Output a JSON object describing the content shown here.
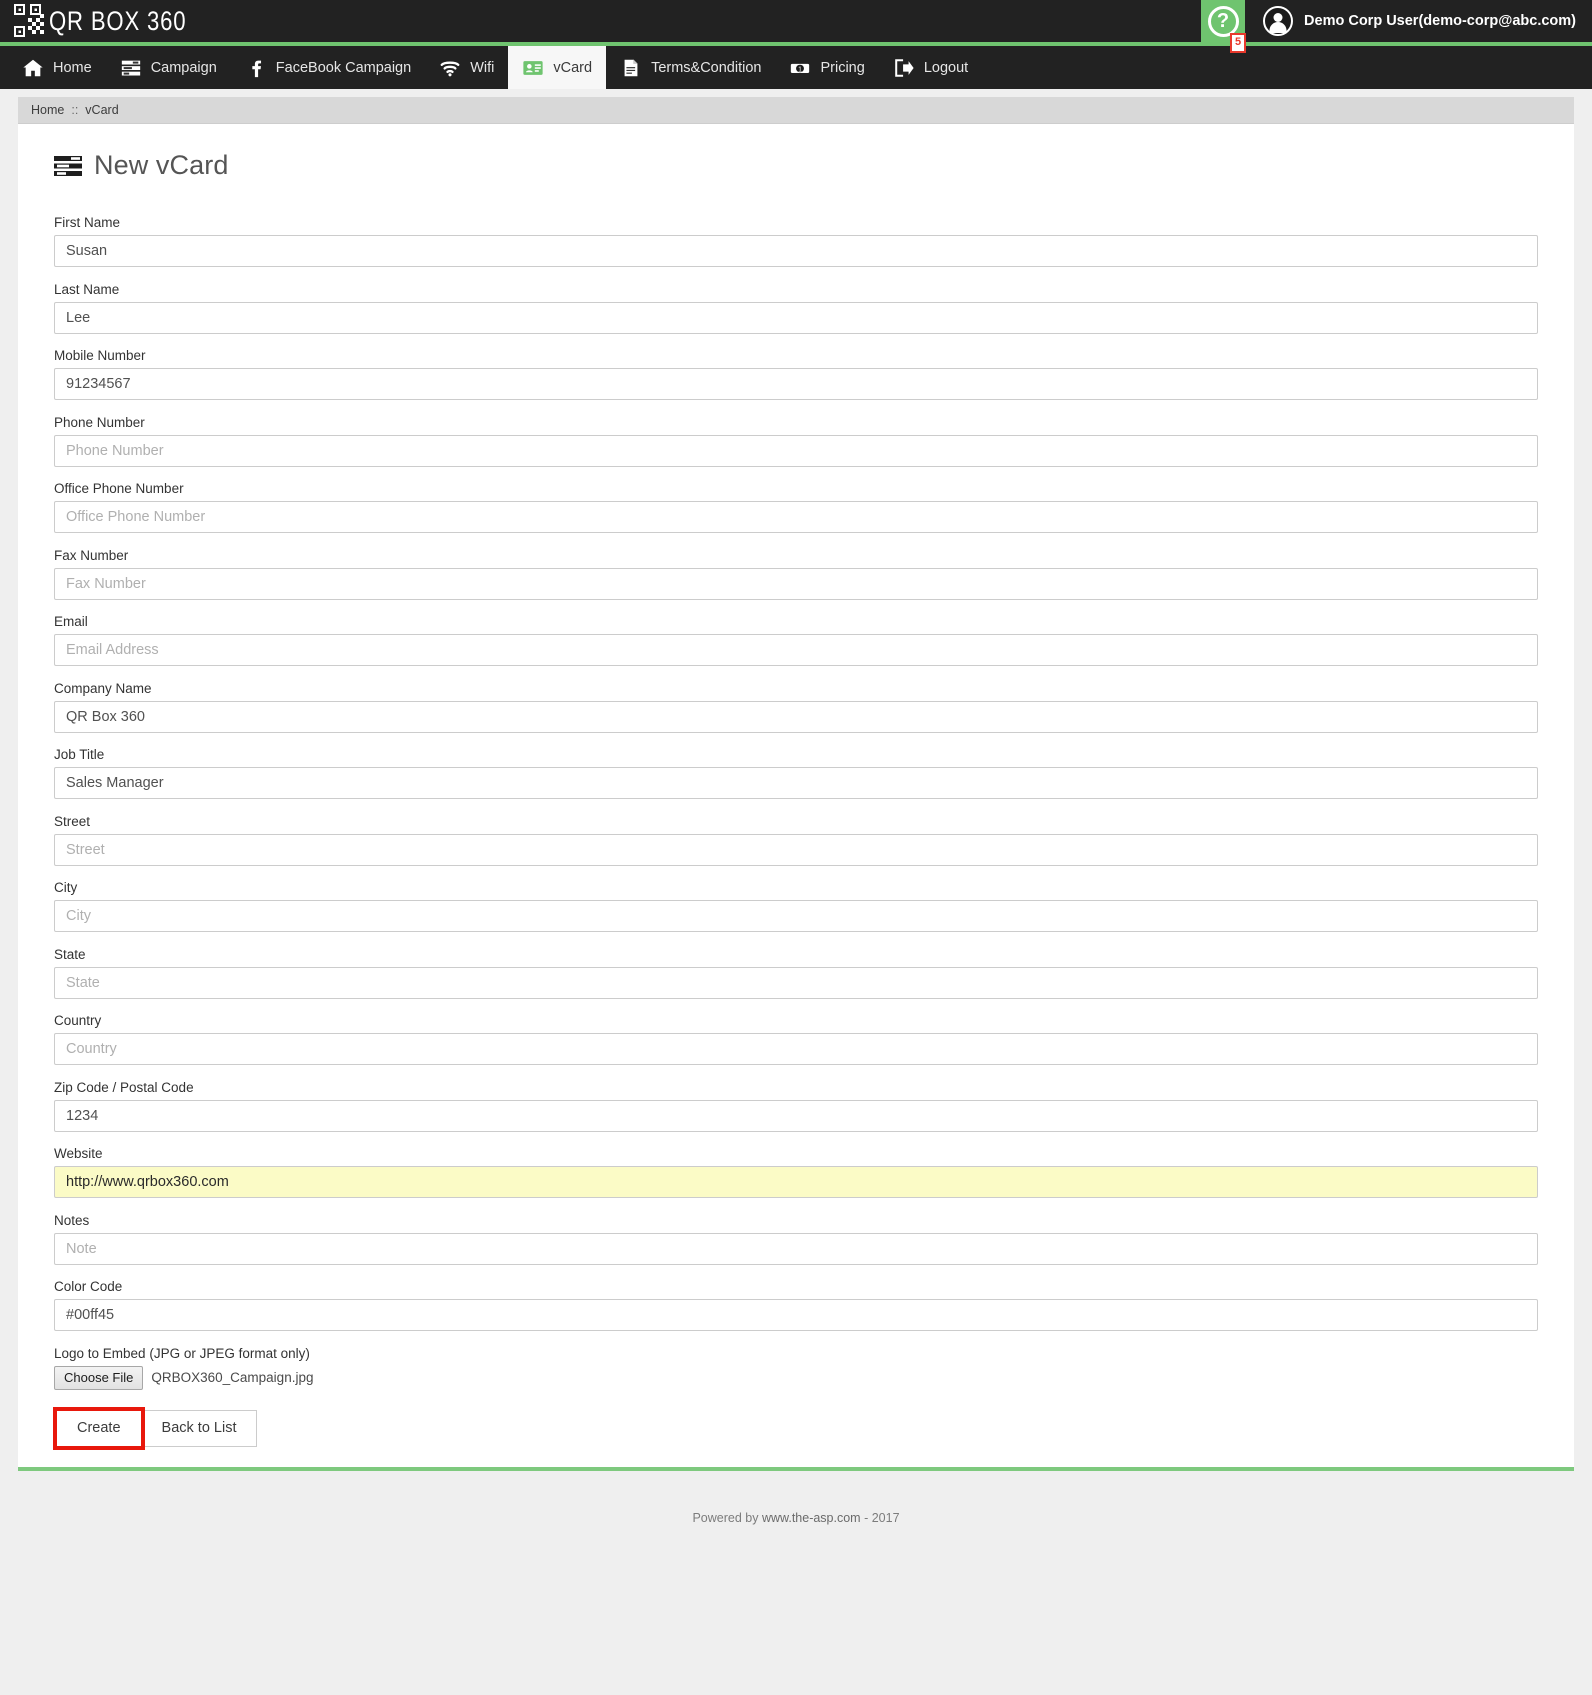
{
  "brand": {
    "name": "QR BOX 360",
    "logo_icon": "qr-code-icon"
  },
  "header": {
    "help_label": "?",
    "help_icon": "question-mark-icon",
    "annotation_badge": "5",
    "avatar_icon": "user-avatar-icon",
    "user_name": "Demo Corp User(demo-corp@abc.com)",
    "accent_color": "#6fc46f",
    "bar_color": "#222222"
  },
  "nav": {
    "items": [
      {
        "label": "Home",
        "icon": "home-icon",
        "active": false
      },
      {
        "label": "Campaign",
        "icon": "list-icon",
        "active": false
      },
      {
        "label": "FaceBook Campaign",
        "icon": "facebook-icon",
        "active": false
      },
      {
        "label": "Wifi",
        "icon": "wifi-icon",
        "active": false
      },
      {
        "label": "vCard",
        "icon": "vcard-icon",
        "active": true
      },
      {
        "label": "Terms&Condition",
        "icon": "document-icon",
        "active": false
      },
      {
        "label": "Pricing",
        "icon": "money-icon",
        "active": false
      },
      {
        "label": "Logout",
        "icon": "logout-icon",
        "active": false
      }
    ]
  },
  "breadcrumb": {
    "home": "Home",
    "separator": "::",
    "current": "vCard"
  },
  "panel": {
    "title": "New vCard",
    "title_icon": "vcard-list-icon",
    "accent_bottom_color": "#7ec97e"
  },
  "form": {
    "fields": [
      {
        "label": "First Name",
        "value": "Susan",
        "placeholder": "First Name",
        "name": "first-name"
      },
      {
        "label": "Last Name",
        "value": "Lee",
        "placeholder": "Last Name",
        "name": "last-name"
      },
      {
        "label": "Mobile Number",
        "value": "91234567",
        "placeholder": "Mobile Number",
        "name": "mobile-number"
      },
      {
        "label": "Phone Number",
        "value": "",
        "placeholder": "Phone Number",
        "name": "phone-number"
      },
      {
        "label": "Office Phone Number",
        "value": "",
        "placeholder": "Office Phone Number",
        "name": "office-phone-number"
      },
      {
        "label": "Fax Number",
        "value": "",
        "placeholder": "Fax Number",
        "name": "fax-number"
      },
      {
        "label": "Email",
        "value": "",
        "placeholder": "Email Address",
        "name": "email"
      },
      {
        "label": "Company Name",
        "value": "QR Box 360",
        "placeholder": "Company Name",
        "name": "company-name"
      },
      {
        "label": "Job Title",
        "value": "Sales Manager",
        "placeholder": "Job Title",
        "name": "job-title"
      },
      {
        "label": "Street",
        "value": "",
        "placeholder": "Street",
        "name": "street"
      },
      {
        "label": "City",
        "value": "",
        "placeholder": "City",
        "name": "city"
      },
      {
        "label": "State",
        "value": "",
        "placeholder": "State",
        "name": "state"
      },
      {
        "label": "Country",
        "value": "",
        "placeholder": "Country",
        "name": "country"
      },
      {
        "label": "Zip Code / Postal Code",
        "value": "1234",
        "placeholder": "Zip Code",
        "name": "zip-code"
      },
      {
        "label": "Website",
        "value": "http://www.qrbox360.com",
        "placeholder": "Website",
        "name": "website",
        "autofilled": true
      },
      {
        "label": "Notes",
        "value": "",
        "placeholder": "Note",
        "name": "notes"
      },
      {
        "label": "Color Code",
        "value": "#00ff45",
        "placeholder": "Color Code",
        "name": "color-code"
      }
    ],
    "upload": {
      "label": "Logo to Embed (JPG or JPEG format only)",
      "button_label": "Choose File",
      "file_name": "QRBOX360_Campaign.jpg"
    },
    "actions": {
      "create_label": "Create",
      "back_label": "Back to List",
      "highlight_color": "#e8180c"
    }
  },
  "footer": {
    "prefix": "Powered by ",
    "link": "www.the-asp.com",
    "suffix": " - 2017"
  }
}
